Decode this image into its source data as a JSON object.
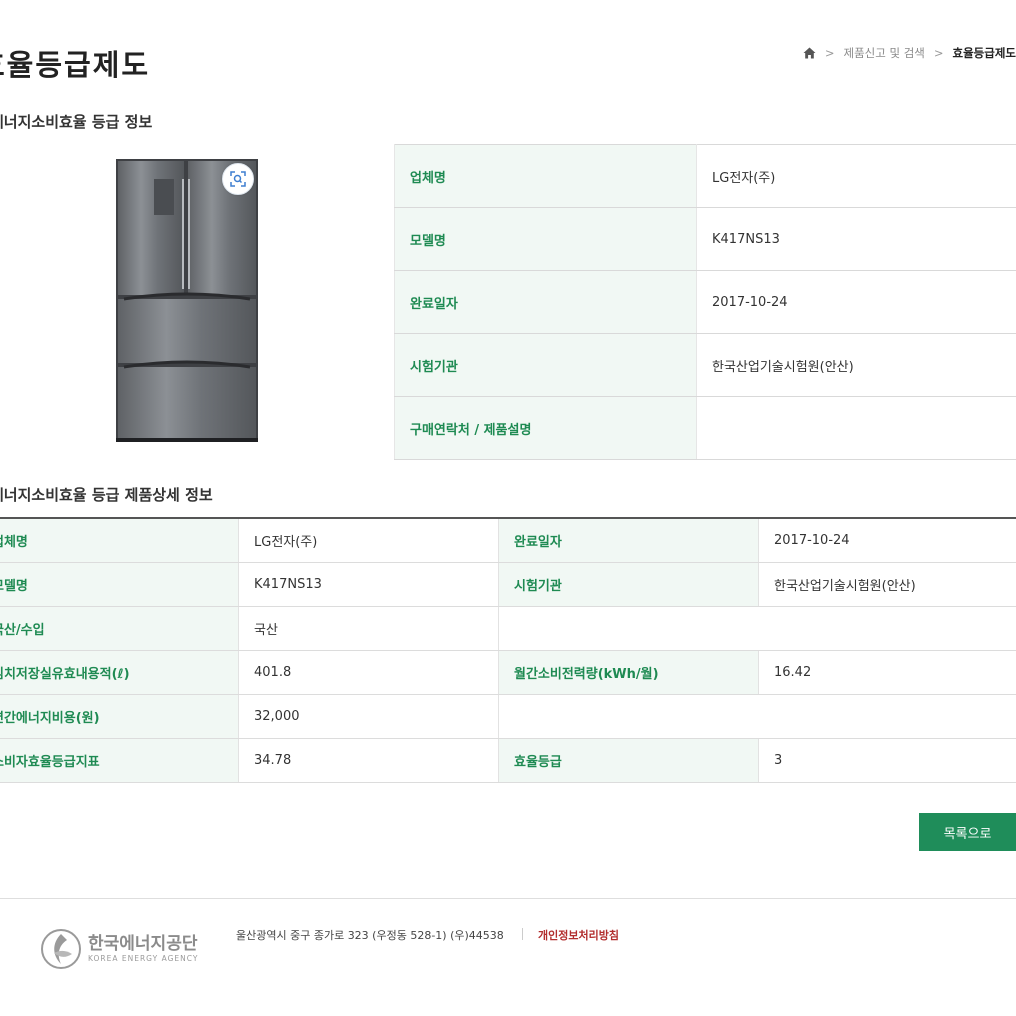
{
  "page_title": "효율등급제도",
  "breadcrumb": {
    "items": [
      "제품신고 및 검색",
      "효율등급제도"
    ]
  },
  "sections": {
    "info_title": "에너지소비효율 등급 정보",
    "detail_title": "에너지소비효율 등급 제품상세 정보"
  },
  "info_table": [
    {
      "label": "업체명",
      "value": "LG전자(주)"
    },
    {
      "label": "모델명",
      "value": "K417NS13"
    },
    {
      "label": "완료일자",
      "value": "2017-10-24"
    },
    {
      "label": "시험기관",
      "value": "한국산업기술시험원(안산)"
    },
    {
      "label": "구매연락처 / 제품설명",
      "value": ""
    }
  ],
  "detail_table": [
    {
      "l1": "업체명",
      "v1": "LG전자(주)",
      "l2": "완료일자",
      "v2": "2017-10-24"
    },
    {
      "l1": "모델명",
      "v1": "K417NS13",
      "l2": "시험기관",
      "v2": "한국산업기술시험원(안산)"
    },
    {
      "l1": "국산/수입",
      "v1": "국산",
      "l2": "",
      "v2": ""
    },
    {
      "l1": "김치저장실유효내용적(ℓ)",
      "v1": "401.8",
      "l2": "월간소비전력량(kWh/월)",
      "v2": "16.42"
    },
    {
      "l1": "연간에너지비용(원)",
      "v1": "32,000",
      "l2": "",
      "v2": ""
    },
    {
      "l1": "소비자효율등급지표",
      "v1": "34.78",
      "l2": "효율등급",
      "v2": "3"
    }
  ],
  "buttons": {
    "list": "목록으로"
  },
  "footer": {
    "logo_korean": "한국에너지공단",
    "logo_english": "KOREA ENERGY AGENCY",
    "address": "울산광역시 중구 종가로 323 (우정동 528-1) (우)44538",
    "privacy": "개인정보처리방침"
  },
  "icons": {
    "home": "home-icon",
    "zoom": "zoom-icon"
  },
  "colors": {
    "accent_green": "#1f8d5a",
    "header_bg": "#f1f8f4",
    "privacy_red": "#b22d2d"
  }
}
